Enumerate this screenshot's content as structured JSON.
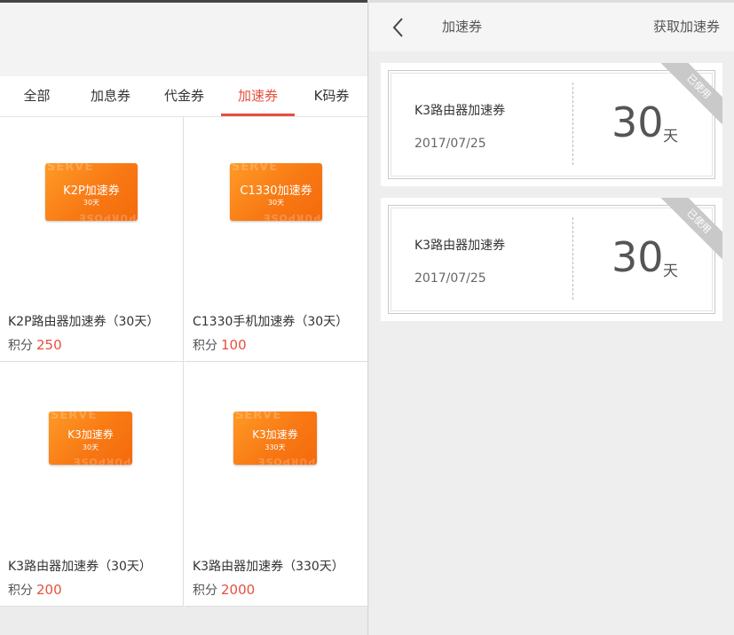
{
  "left": {
    "tabs": [
      {
        "label": "全部"
      },
      {
        "label": "加息券"
      },
      {
        "label": "代金券"
      },
      {
        "label": "加速券"
      },
      {
        "label": "K码券"
      }
    ],
    "active_tab": "加速券",
    "points_label": "积分",
    "products": [
      {
        "card_title": "K2P加速券",
        "card_days": "30天",
        "name": "K2P路由器加速券（30天）",
        "points": "250"
      },
      {
        "card_title": "C1330加速券",
        "card_days": "30天",
        "name": "C1330手机加速券（30天）",
        "points": "100"
      },
      {
        "card_title": "K3加速券",
        "card_days": "30天",
        "name": "K3路由器加速券（30天）",
        "points": "200"
      },
      {
        "card_title": "K3加速券",
        "card_days": "330天",
        "name": "K3路由器加速券（330天）",
        "points": "2000"
      }
    ],
    "card_watermark_top": "SERVE",
    "card_watermark_bottom": "PURPOSE"
  },
  "right": {
    "header": {
      "back_icon": "chevron-left-icon",
      "title": "加速券",
      "action": "获取加速券"
    },
    "coupons": [
      {
        "title": "K3路由器加速券",
        "date": "2017/07/25",
        "value": "30",
        "unit": "天",
        "status": "已使用"
      },
      {
        "title": "K3路由器加速券",
        "date": "2017/07/25",
        "value": "30",
        "unit": "天",
        "status": "已使用"
      }
    ]
  },
  "colors": {
    "accent": "#e5503e",
    "card_orange": "#f87914",
    "used_ribbon": "#c9c9c9"
  }
}
